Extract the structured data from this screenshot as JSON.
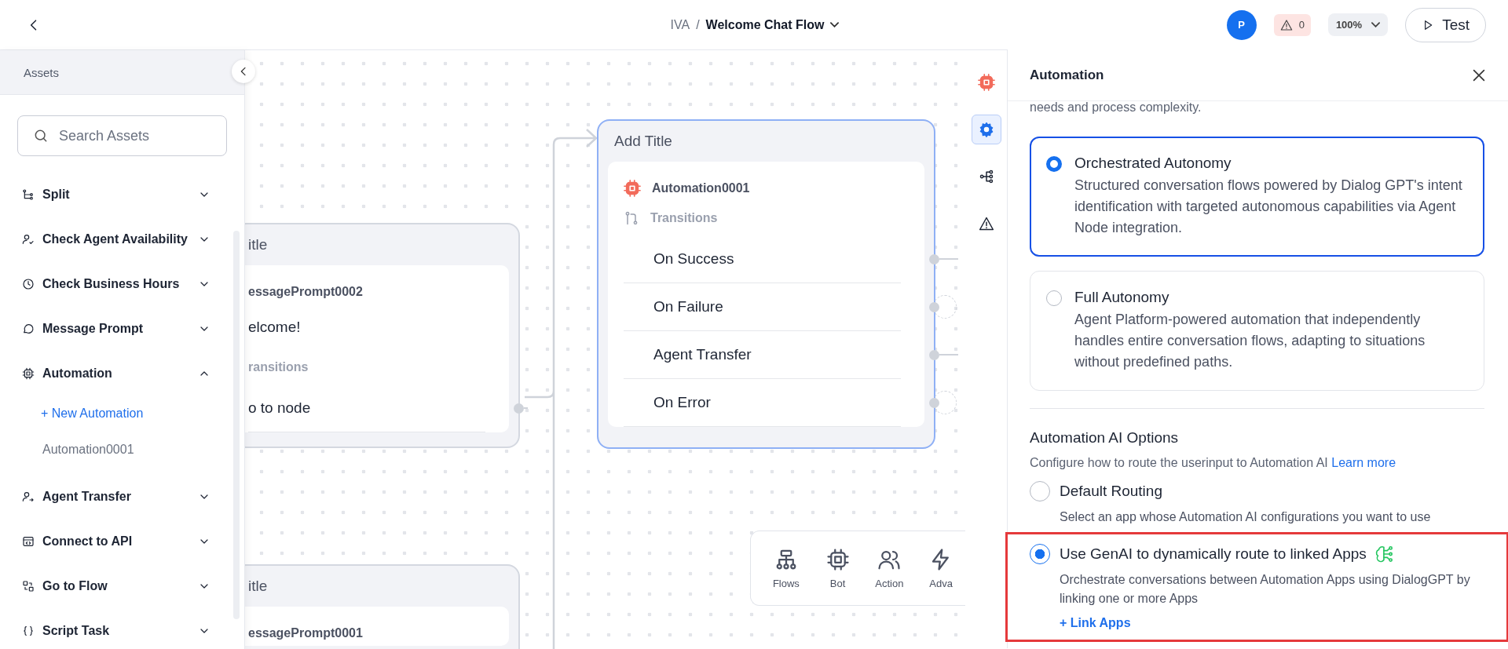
{
  "top_bar": {
    "breadcrumb": [
      "IVA",
      "Welcome Chat Flow"
    ],
    "separator": "/",
    "avatar": "P",
    "warnings": "0",
    "zoom": "100%",
    "test_button": "Test"
  },
  "sidebar": {
    "title": "Assets",
    "search": {
      "placeholder": "Search Assets"
    },
    "items": [
      {
        "label": "Split",
        "kind": "split",
        "expanded": false
      },
      {
        "label": "Check Agent Availability",
        "kind": "agent-check",
        "expanded": false
      },
      {
        "label": "Check Business Hours",
        "kind": "clock",
        "expanded": false
      },
      {
        "label": "Message Prompt",
        "kind": "chat",
        "expanded": false
      },
      {
        "label": "Automation",
        "kind": "chip",
        "expanded": true,
        "children": [
          {
            "label": "+ New Automation",
            "kind": "add"
          },
          {
            "label": "Automation0001",
            "kind": "entry"
          }
        ]
      },
      {
        "label": "Agent Transfer",
        "kind": "agent-transfer",
        "expanded": false
      },
      {
        "label": "Connect to API",
        "kind": "api",
        "expanded": false
      },
      {
        "label": "Go to Flow",
        "kind": "flow",
        "expanded": false
      },
      {
        "label": "Script Task",
        "kind": "braces",
        "expanded": false
      }
    ]
  },
  "canvas": {
    "nodes": [
      {
        "kind": "message",
        "title": "itle",
        "asset": "essagePrompt0002",
        "message": "elcome!",
        "transitions_label": "ransitions",
        "transitions": [
          {
            "label": "o to node",
            "connected": true
          }
        ]
      },
      {
        "kind": "automation",
        "title": "Add Title",
        "asset": "Automation0001",
        "transitions_label": "Transitions",
        "transitions": [
          {
            "label": "On Success",
            "connected": true
          },
          {
            "label": "On Failure",
            "connected": false
          },
          {
            "label": "Agent Transfer",
            "connected": true
          },
          {
            "label": "On Error",
            "connected": false
          }
        ]
      },
      {
        "kind": "message",
        "title": "itle",
        "asset": "essagePrompt0001"
      }
    ],
    "palette": [
      {
        "label": "Flows",
        "kind": "flows"
      },
      {
        "label": "Bot",
        "kind": "bot"
      },
      {
        "label": "Action",
        "kind": "action"
      },
      {
        "label": "Adva",
        "kind": "advanced"
      }
    ]
  },
  "tool_strip": [
    {
      "kind": "chip",
      "selected": false
    },
    {
      "kind": "gear",
      "selected": true
    },
    {
      "kind": "tree",
      "selected": false
    },
    {
      "kind": "warning",
      "selected": false
    }
  ],
  "panel": {
    "title": "Automation",
    "intro": "needs and process complexity.",
    "modes": [
      {
        "title": "Orchestrated Autonomy",
        "description": "Structured conversation flows powered by Dialog GPT's intent identification with targeted autonomous capabilities via Agent Node integration.",
        "selected": true
      },
      {
        "title": "Full Autonomy",
        "description": "Agent Platform-powered automation that independently handles entire conversation flows, adapting to situations without predefined paths.",
        "selected": false
      }
    ],
    "ai_options": {
      "title": "Automation AI Options",
      "description": "Configure how to route the userinput to Automation AI",
      "link": "Learn more",
      "options": [
        {
          "label": "Default Routing",
          "description": "Select an app whose Automation AI configurations you want to use",
          "selected": false,
          "highlighted": false
        },
        {
          "label": "Use GenAI to dynamically route to linked Apps",
          "description": "Orchestrate conversations between Automation Apps using DialogGPT by linking one or more Apps",
          "action": "+ Link Apps",
          "selected": true,
          "highlighted": true,
          "genai": true
        }
      ]
    }
  }
}
